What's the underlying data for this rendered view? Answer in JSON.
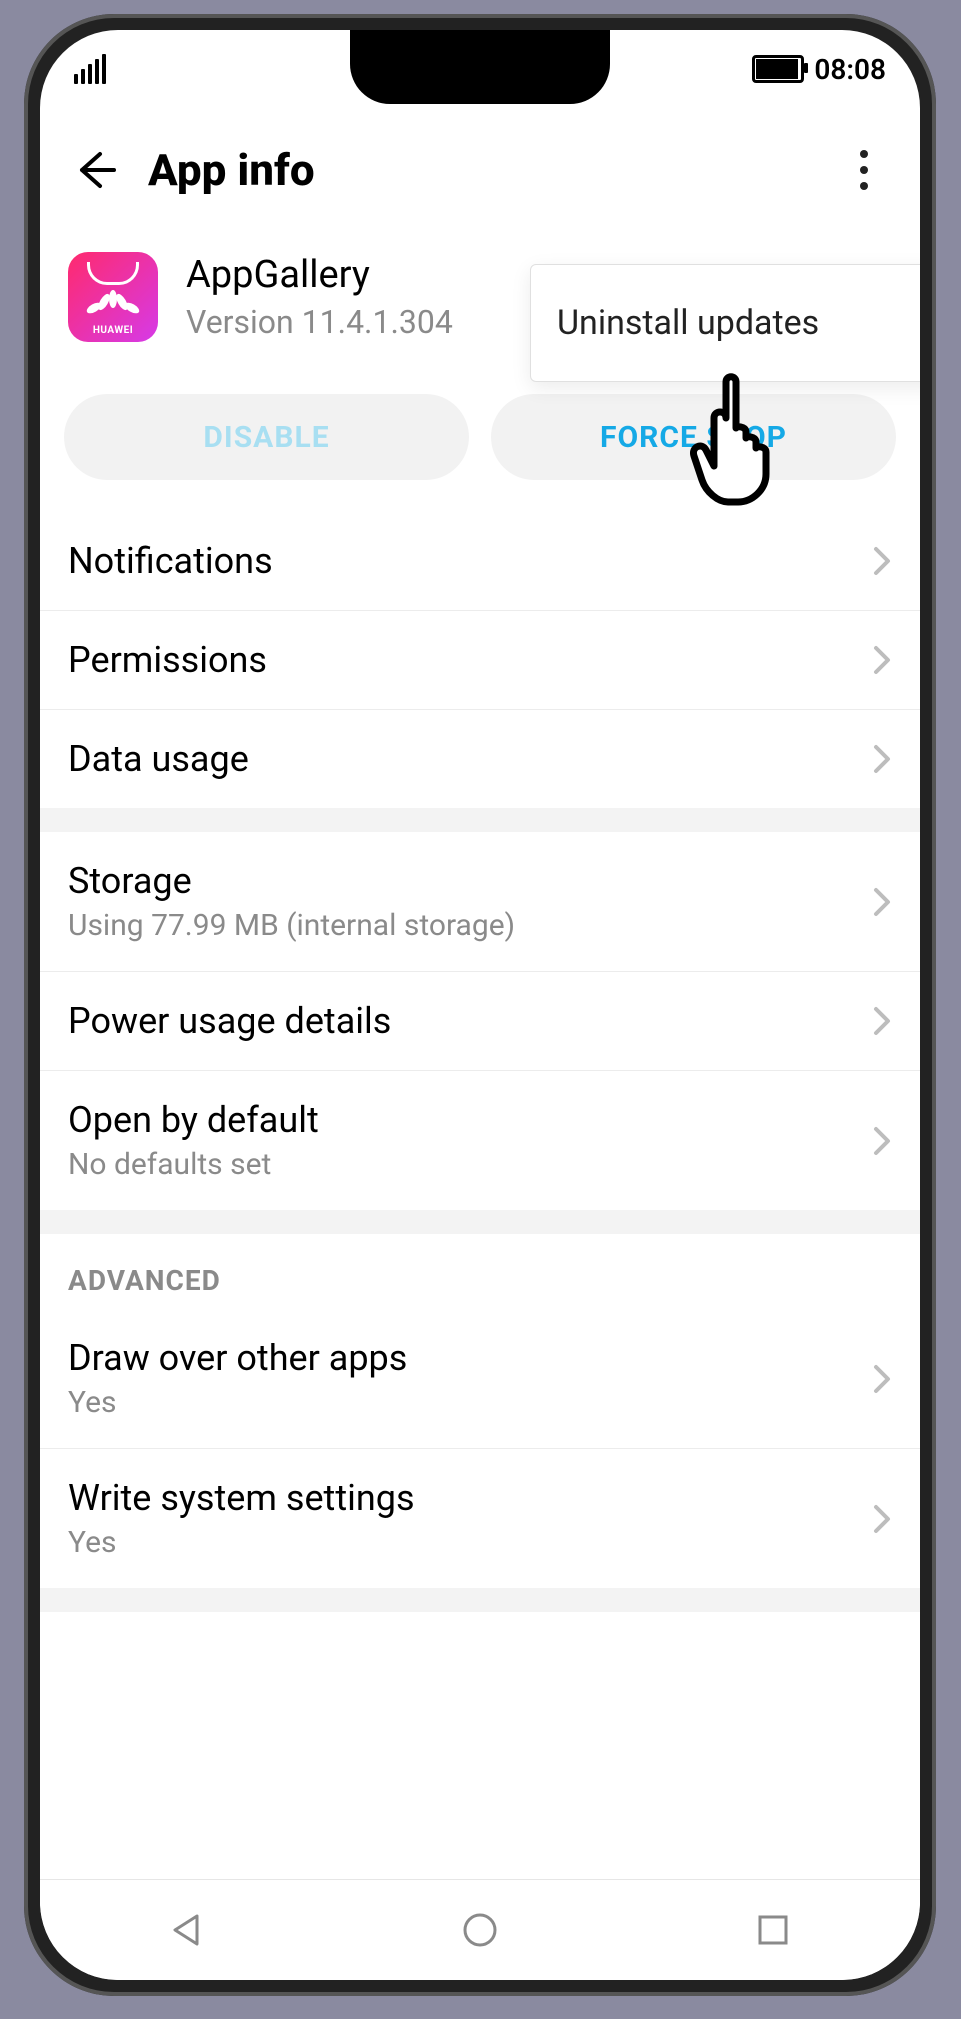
{
  "status": {
    "time": "08:08"
  },
  "header": {
    "title": "App info"
  },
  "app": {
    "name": "AppGallery",
    "version": "Version 11.4.1.304",
    "brand": "HUAWEI"
  },
  "actions": {
    "disable": "DISABLE",
    "force_stop": "FORCE STOP"
  },
  "popup": {
    "label": "Uninstall updates"
  },
  "sections": {
    "general": [
      {
        "title": "Notifications"
      },
      {
        "title": "Permissions"
      },
      {
        "title": "Data usage"
      }
    ],
    "storage": [
      {
        "title": "Storage",
        "sub": "Using 77.99 MB (internal storage)"
      },
      {
        "title": "Power usage details"
      },
      {
        "title": "Open by default",
        "sub": "No defaults set"
      }
    ],
    "advanced_label": "ADVANCED",
    "advanced": [
      {
        "title": "Draw over other apps",
        "sub": "Yes"
      },
      {
        "title": "Write system settings",
        "sub": "Yes"
      }
    ]
  }
}
